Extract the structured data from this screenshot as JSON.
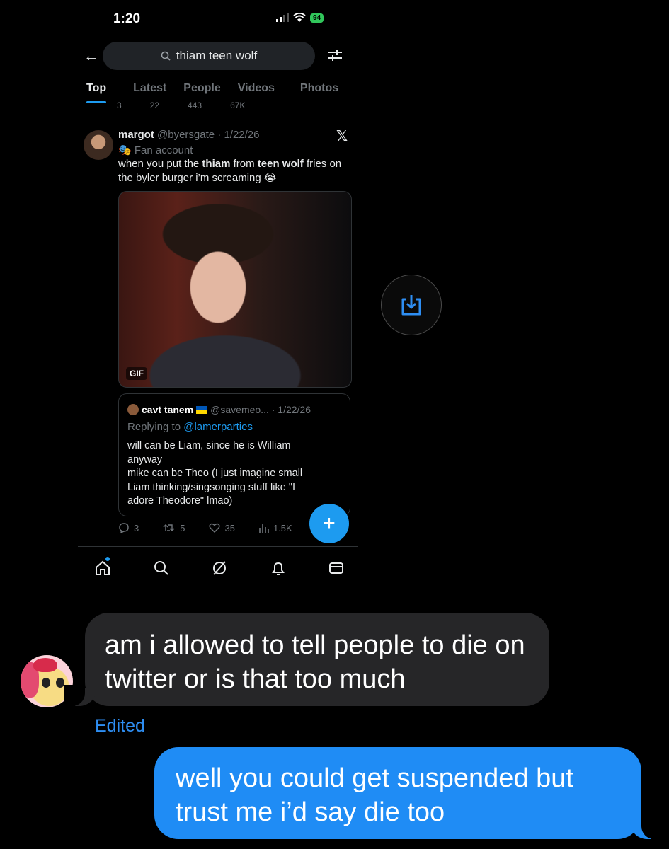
{
  "status": {
    "time": "1:20",
    "battery": "94"
  },
  "search": {
    "query": "thiam teen wolf"
  },
  "tabs": [
    "Top",
    "Latest",
    "People",
    "Videos",
    "Photos"
  ],
  "prev_tweet_stats": {
    "replies": "3",
    "reposts": "22",
    "likes": "443",
    "views": "67K"
  },
  "tweet": {
    "display_name": "margot",
    "handle_date": "@byersgate · 1/22/26",
    "label": "Fan account",
    "text_parts": {
      "p1": "when you put the ",
      "b1": "thiam",
      "p2": " from ",
      "b2": "teen wolf",
      "p3": " fries on the byler burger i’m screaming 😭"
    },
    "media_badge": "GIF",
    "stats": {
      "replies": "3",
      "reposts": "5",
      "likes": "35",
      "views": "1.5K"
    }
  },
  "quote": {
    "display_name": "cavt tanem",
    "handle_date": "@savemeo... · 1/22/26",
    "replying_prefix": "Replying to ",
    "replying_handle": "@lamerparties",
    "text": "will can be Liam, since he is William\nanyway\nmike can be Theo (I just imagine small\nLiam thinking/singsonging stuff like \"I\nadore Theodore\" lmao)"
  },
  "messages": {
    "incoming": "am i allowed to tell people to die on twitter or is that too much",
    "edited_label": "Edited",
    "outgoing": "well you could get suspended but trust me i’d say die too"
  },
  "colors": {
    "accent": "#1d9bf0",
    "outgoing_bubble": "#1f8cf5",
    "incoming_bubble": "#262628"
  }
}
